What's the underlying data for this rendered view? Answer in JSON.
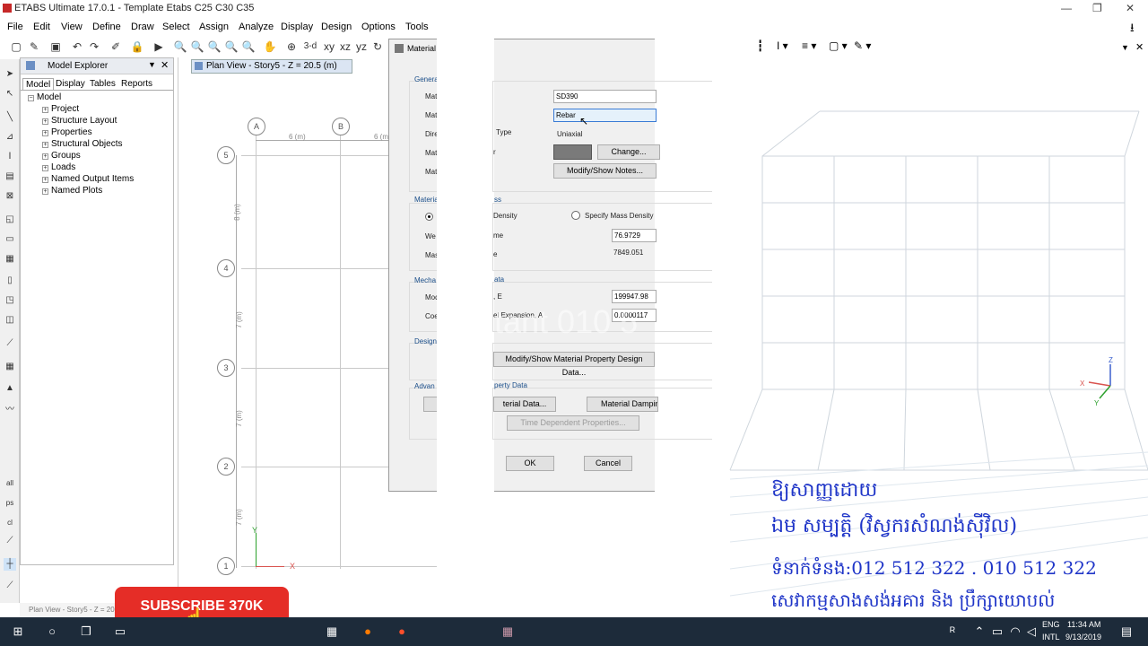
{
  "window": {
    "title": "ETABS Ultimate 17.0.1 - Template Etabs C25 C30 C35",
    "min": "—",
    "max": "❐",
    "close": "✕"
  },
  "menu": [
    "File",
    "Edit",
    "View",
    "Define",
    "Draw",
    "Select",
    "Assign",
    "Analyze",
    "Display",
    "Design",
    "Options",
    "Tools"
  ],
  "toolbar": {
    "view3d_label": "3-d"
  },
  "explorer": {
    "title": "Model Explorer",
    "tabs": [
      "Model",
      "Display",
      "Tables",
      "Reports"
    ],
    "root": "Model",
    "items": [
      "Project",
      "Structure Layout",
      "Properties",
      "Structural Objects",
      "Groups",
      "Loads",
      "Named Output Items",
      "Named Plots"
    ]
  },
  "plan": {
    "tab_title": "Plan View - Story5 - Z = 20.5 (m)",
    "col_bubbles": [
      "A",
      "B"
    ],
    "row_bubbles": [
      "5",
      "4",
      "3",
      "2",
      "1"
    ],
    "dim_x": [
      "6 (m)",
      "6 (m"
    ],
    "dim_y": [
      "8 (m)",
      "7 (m)",
      "7 (m)",
      "7 (m)"
    ],
    "axis_y": "Y",
    "axis_x": "X",
    "status": "Plan View - Story5 - Z = 20.5 (m)"
  },
  "dialog": {
    "title": "Material",
    "close": "✕",
    "general_label": "Genera",
    "row_labels": [
      "Mat",
      "Mat",
      "Dire",
      "Mat",
      "Mat"
    ],
    "dir_type_suffix": "Type",
    "color_suffix": "r",
    "name_value": "SD390",
    "type_value": "Rebar",
    "symmetry_value": "Uniaxial",
    "change_btn": "Change...",
    "notes_btn": "Modify/Show Notes...",
    "weight_group": "Materia",
    "weight_group_suffix": "ss",
    "density_left": "Density",
    "density_right": "Specify Mass Density",
    "weight_label": "We",
    "weight_suffix": "me",
    "mass_label": "Mas",
    "mass_suffix": "e",
    "weight_value": "76.9729",
    "mass_value": "7849.051",
    "mech_group": "Mecha",
    "mech_group_suffix": "ata",
    "mod_label": "Mod",
    "mod_suffix": ", E",
    "coef_label": "Coe",
    "coef_suffix": "el Expansion,  A",
    "mod_value": "199947.98",
    "coef_value": "0.0000117",
    "design_group": "Design",
    "design_btn": "Modify/Show Material Property Design Data...",
    "adv_group": "Advan",
    "adv_group_suffix": "perty Data",
    "nonlinear_btn": "terial Data...",
    "damping_btn": "Material Dampin",
    "time_btn": "Time Dependent Properties...",
    "ok": "OK",
    "cancel": "Cancel",
    "watermark": "tant 010 5"
  },
  "overlay": {
    "subscribe": "SUBSCRIBE  370K",
    "line1": "ឱ្យសាញ្ញដោយ",
    "line2": "ឯម សម្បត្តិ (វិស្វករសំណង់ស៊ីវិល)",
    "line3": "ទំនាក់ទំនង:012 512 322 . 010 512 322",
    "line4": "សេវាកម្មសាងសង់អគារ និង ប្រឹក្សាយោបល់"
  },
  "tray": {
    "lang1": "ENG",
    "lang2": "INTL",
    "time": "11:34 AM",
    "date": "9/13/2019"
  },
  "colors": {
    "accent_khmer": "#1f35c8",
    "subscribe_red": "#e52d27",
    "taskbar": "#1d2b3a"
  }
}
